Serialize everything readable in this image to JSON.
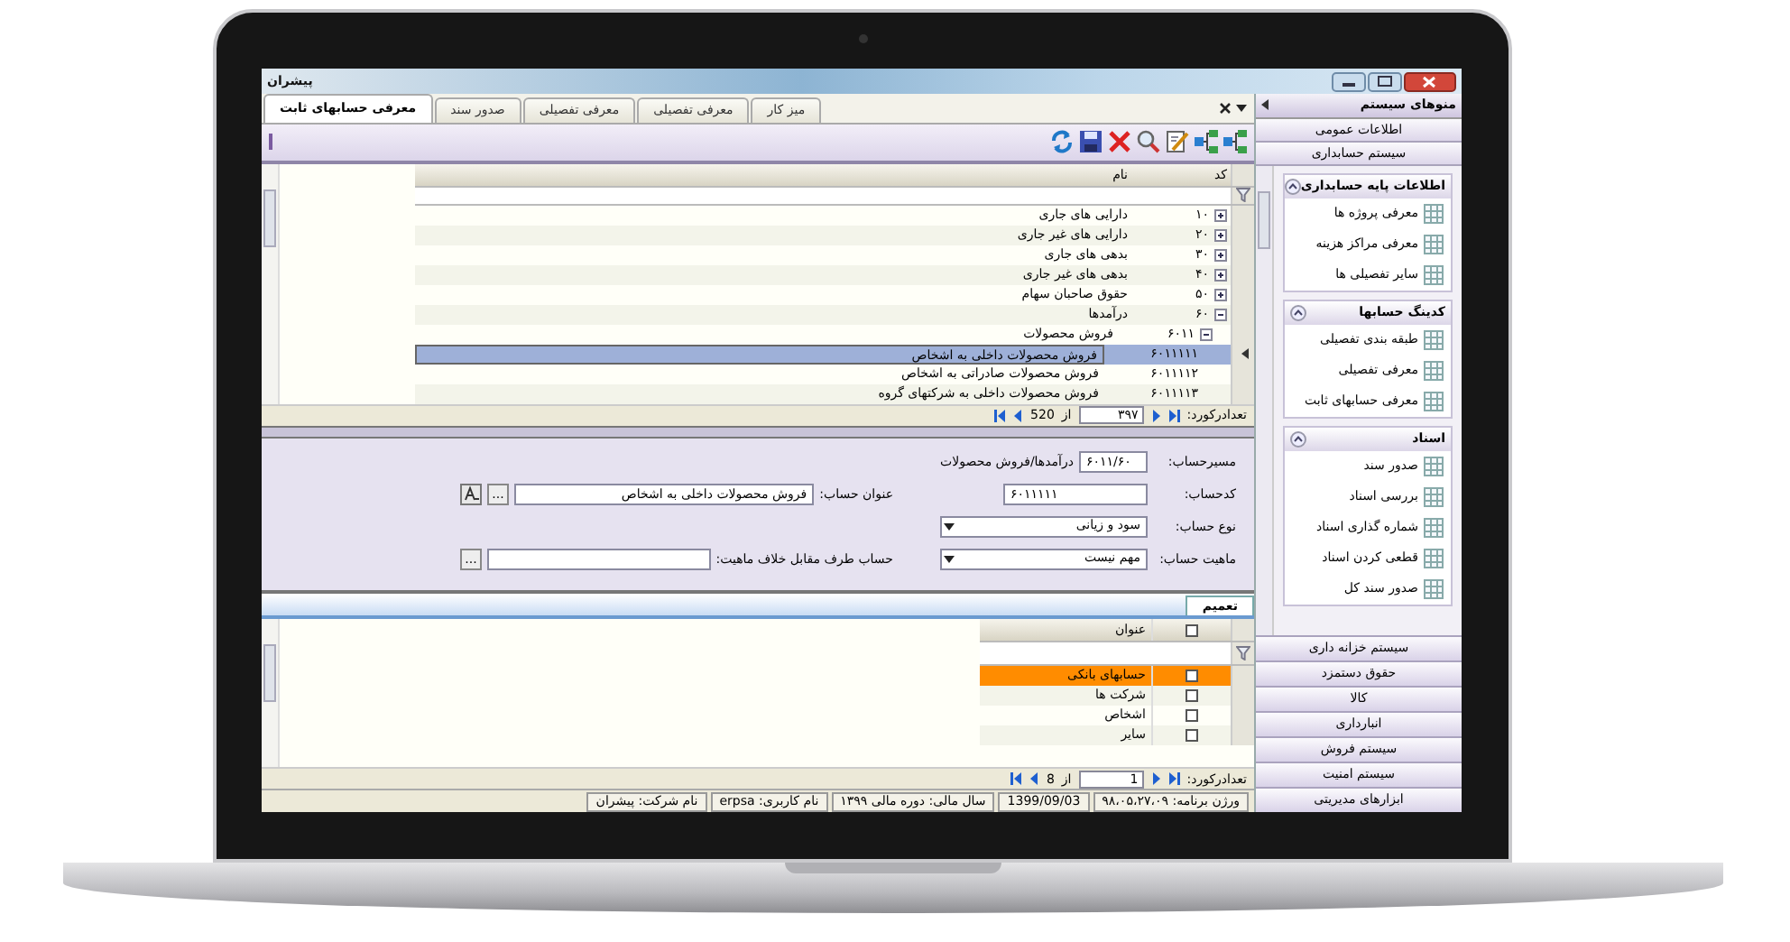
{
  "window": {
    "title": "پیشران"
  },
  "tabs": [
    {
      "label": "میز کار",
      "selected": false
    },
    {
      "label": "معرفی تفصیلی",
      "selected": false
    },
    {
      "label": "معرفی تفصیلی",
      "selected": false
    },
    {
      "label": "صدور سند",
      "selected": false
    },
    {
      "label": "معرفی حسابهای ثابت",
      "selected": true
    }
  ],
  "table": {
    "columns": [
      "کد",
      "نام"
    ],
    "rows": [
      {
        "code": "۱۰",
        "name": "دارایی های جاری",
        "expanded": false,
        "selected": false
      },
      {
        "code": "۲۰",
        "name": "دارایی های غیر جاری",
        "expanded": false,
        "selected": false
      },
      {
        "code": "۳۰",
        "name": "بدهی های جاری",
        "expanded": false,
        "selected": false
      },
      {
        "code": "۴۰",
        "name": "بدهی های غیر جاری",
        "expanded": false,
        "selected": false
      },
      {
        "code": "۵۰",
        "name": "حقوق صاحبان سهام",
        "expanded": false,
        "selected": false
      },
      {
        "code": "۶۰",
        "name": "درآمدها",
        "expanded": true,
        "selected": false,
        "children": [
          {
            "code": "۶۰۱۱",
            "name": "فروش محصولات",
            "expanded": true,
            "selected": false,
            "children": [
              {
                "code": "۶۰۱۱۱۱۱",
                "name": "فروش محصولات داخلی به اشخاص",
                "selected": true
              },
              {
                "code": "۶۰۱۱۱۱۲",
                "name": "فروش محصولات صادراتی به اشخاص",
                "selected": false
              },
              {
                "code": "۶۰۱۱۱۱۳",
                "name": "فروش محصولات داخلی به شرکتهای گروه",
                "selected": false
              }
            ]
          }
        ]
      }
    ]
  },
  "pager": {
    "label": "تعدادرکورد:",
    "current": "۳۹۷",
    "of": "از",
    "total": "520"
  },
  "form": {
    "rows": [
      [
        {
          "kind": "path",
          "label": "مسیرحساب:",
          "value": "۶۰۱۱/۶۰",
          "note": "درآمدها/فروش محصولات"
        }
      ],
      [
        {
          "kind": "input",
          "label": "کدحساب:",
          "value": "۶۰۱۱۱۱۱"
        },
        {
          "kind": "lookup",
          "label": "عنوان حساب:",
          "value": "فروش محصولات داخلی به اشخاص",
          "button": "...",
          "translate": true
        }
      ],
      [
        {
          "kind": "select",
          "label": "نوع حساب:",
          "value": "سود و زیانی"
        }
      ],
      [
        {
          "kind": "select",
          "label": "ماهیت حساب:",
          "value": "مهم نیست"
        },
        {
          "kind": "lookup",
          "label": "حساب طرف مقابل خلاف ماهیت:",
          "button": "...",
          "translate": false
        }
      ]
    ]
  },
  "detail": {
    "tabs": [
      {
        "label": "تعمیم",
        "selected": true
      }
    ],
    "header_checked": false,
    "column": "عنوان",
    "rows": [
      {
        "title": "حسابهای بانکی",
        "checked": false,
        "selected": true
      },
      {
        "title": "شرکت ها",
        "checked": false,
        "selected": false
      },
      {
        "title": "اشخاص",
        "checked": false,
        "selected": false
      },
      {
        "title": "سایر",
        "checked": false,
        "selected": false
      }
    ],
    "pager": {
      "label": "تعدادرکورد:",
      "current": "1",
      "of": "از",
      "total": "8"
    }
  },
  "sidebar": {
    "header": "منوهای سیستم",
    "top_items": [
      "اطلاعات عمومی",
      "سیستم حسابداری"
    ],
    "groups": [
      {
        "title": "اطلاعات پایه حسابداری",
        "expanded": true,
        "items": [
          "معرفی پروژه ها",
          "معرفی مراکز هزینه",
          "سایر تفصیلی ها"
        ]
      },
      {
        "title": "کدینگ حسابها",
        "expanded": true,
        "items": [
          "طبقه بندی تفصیلی",
          "معرفی تفصیلی",
          "معرفی حسابهای ثابت"
        ]
      },
      {
        "title": "اسناد",
        "expanded": true,
        "items": [
          "صدور سند",
          "بررسی اسناد",
          "شماره گذاری اسناد",
          "قطعی کردن اسناد",
          "صدور سند کل"
        ]
      }
    ],
    "bottom_items": [
      "سیستم خزانه داری",
      "حقوق دستمزد",
      "کالا",
      "انبارداری",
      "سیستم فروش",
      "سیستم امنیت",
      "ابزارهای مدیریتی"
    ]
  },
  "status_bar": [
    "ورژن برنامه: ۹۸،۰۵،۲۷،۰۹",
    "1399/09/03",
    "سال مالی: دوره مالی ۱۳۹۹",
    "نام کاربری: erpsa",
    "نام شرکت: پیشران"
  ]
}
